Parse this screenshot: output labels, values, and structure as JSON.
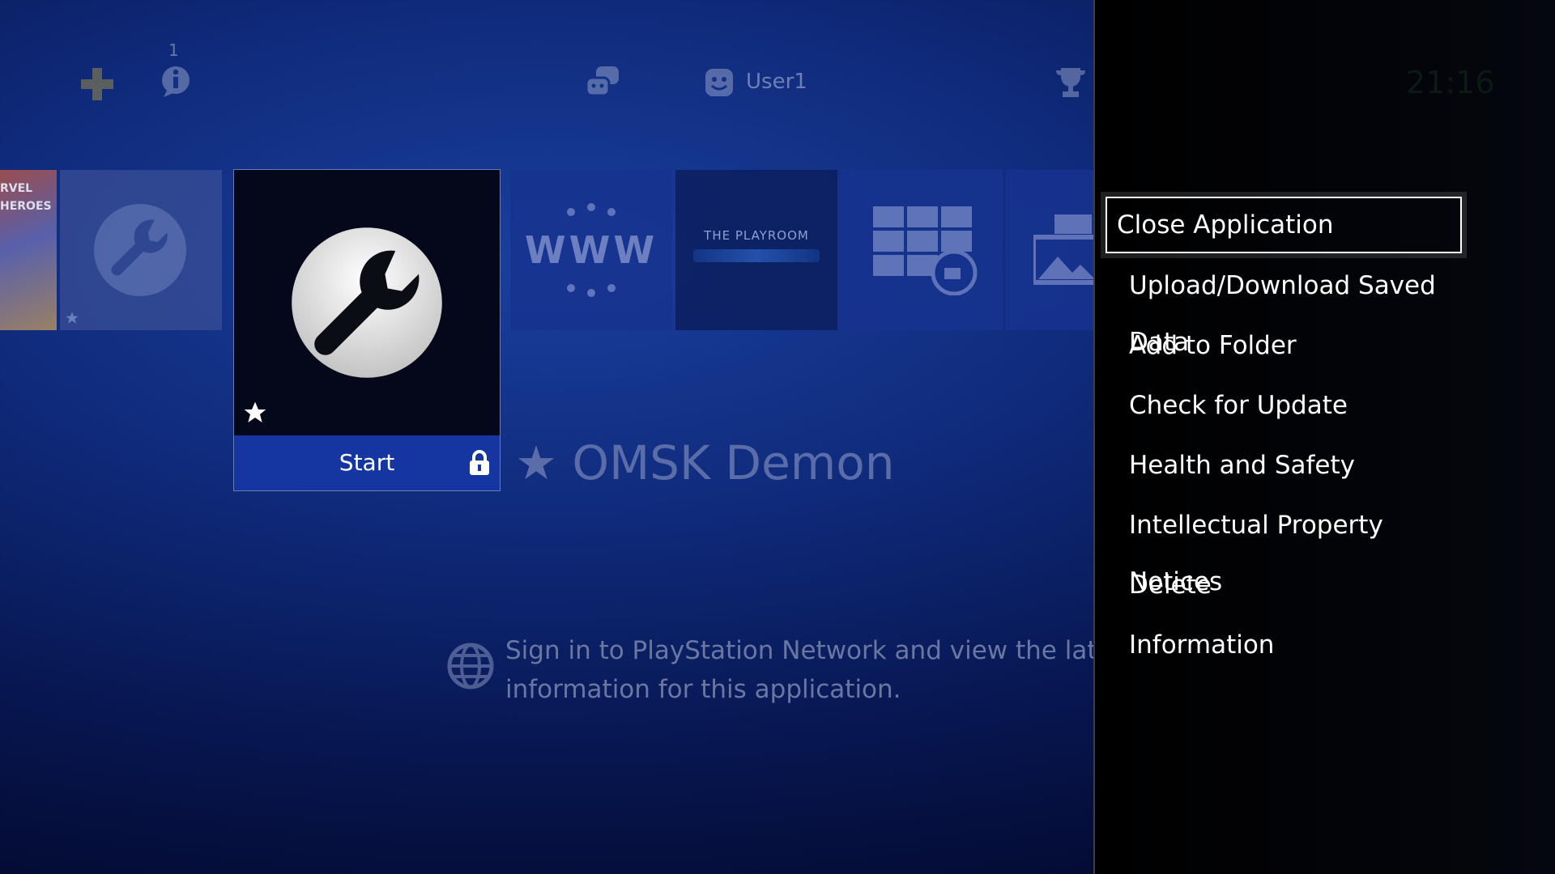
{
  "topbar": {
    "notification_count": "1",
    "user_name": "User1",
    "clock": "21:16",
    "icons": [
      "ps-plus-icon",
      "notifications-icon",
      "friends-icon",
      "profile-icon",
      "trophy-icon"
    ]
  },
  "library": {
    "tiles": [
      {
        "name": "Marvel game",
        "label": "RVEL HEROES"
      },
      {
        "name": "Tool"
      },
      {
        "name": "Selected app"
      },
      {
        "name": "Internet Browser",
        "label": "WWW"
      },
      {
        "name": "The Playroom",
        "label": "THE PLAYROOM"
      },
      {
        "name": "Live from PlayStation"
      },
      {
        "name": "Capture Gallery"
      }
    ],
    "selected": {
      "start_label": "Start",
      "title": "★ OMSK Demon"
    }
  },
  "info": {
    "line1": "Sign in to PlayStation Network and view the latest",
    "line2": "information for this application."
  },
  "options_menu": {
    "items": [
      "Close Application",
      "Upload/Download Saved Data",
      "Add to Folder",
      "Check for Update",
      "Health and Safety",
      "Intellectual Property Notices",
      "Delete",
      "Information"
    ],
    "focused_index": 0
  },
  "colors": {
    "bg_blue": "#0f2a7a",
    "panel_black": "#000000",
    "start_bar": "#1536a0"
  }
}
